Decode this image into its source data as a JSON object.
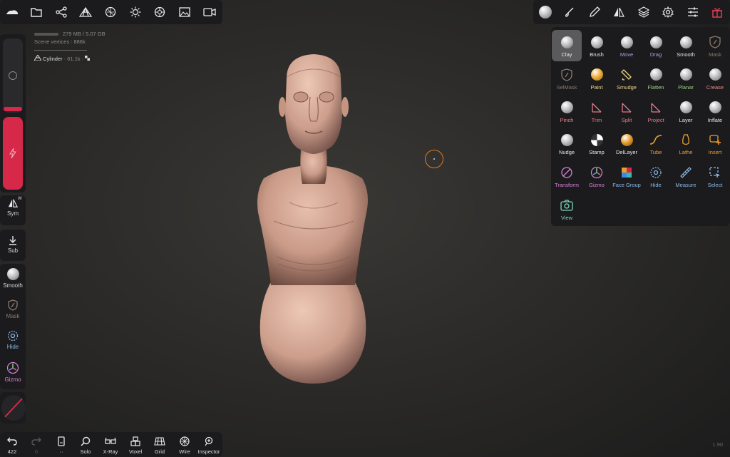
{
  "top_toolbar": {
    "icons": [
      "app-logo-icon",
      "folder-icon",
      "scene-graph-icon",
      "topology-icon",
      "background-icon",
      "light-icon",
      "material-icon",
      "image-icon",
      "video-icon"
    ]
  },
  "top_right_toolbar": {
    "icons": [
      "brush-sphere-icon",
      "paint-brush-icon",
      "pen-tool-icon",
      "symmetry-icon",
      "layers-icon",
      "settings-gear-icon",
      "sliders-icon",
      "gift-icon"
    ],
    "accent": "#e84055"
  },
  "scene_info": {
    "memory": "279 MB / 5.07 GB",
    "vertices": "Scene vertices : 888k",
    "object_name": "Cylinder",
    "object_detail": "· 61.1k ·"
  },
  "left_panel": {
    "sym_label": "Sym",
    "sym_badge": "W",
    "sub_label": "Sub",
    "smooth_label": "Smooth",
    "mask_label": "Mask",
    "hide_label": "Hide",
    "gizmo_label": "Gizmo",
    "slider_accent": "#d6294a"
  },
  "tools": [
    {
      "name": "Clay",
      "color": "#e8e8e8"
    },
    {
      "name": "Brush",
      "color": "#e8e8e8"
    },
    {
      "name": "Move",
      "color": "#a9a7e8"
    },
    {
      "name": "Drag",
      "color": "#a9a7e8"
    },
    {
      "name": "Smooth",
      "color": "#e8e8e8"
    },
    {
      "name": "Mask",
      "color": "#8a7a6a"
    },
    {
      "name": "SelMask",
      "color": "#8a7a6a"
    },
    {
      "name": "Paint",
      "color": "#f0d58a"
    },
    {
      "name": "Smudge",
      "color": "#f0d58a"
    },
    {
      "name": "Flatten",
      "color": "#9ad18a"
    },
    {
      "name": "Planar",
      "color": "#9ad18a"
    },
    {
      "name": "Crease",
      "color": "#e88a8a"
    },
    {
      "name": "Pinch",
      "color": "#e88a8a"
    },
    {
      "name": "Trim",
      "color": "#e07a8a"
    },
    {
      "name": "Split",
      "color": "#e07a8a"
    },
    {
      "name": "Project",
      "color": "#e07a8a"
    },
    {
      "name": "Layer",
      "color": "#e8e8e8"
    },
    {
      "name": "Inflate",
      "color": "#e8e8e8"
    },
    {
      "name": "Nudge",
      "color": "#e8e8e8"
    },
    {
      "name": "Stamp",
      "color": "#e8e8e8"
    },
    {
      "name": "DelLayer",
      "color": "#e8e8e8"
    },
    {
      "name": "Tube",
      "color": "#e8a030"
    },
    {
      "name": "Lathe",
      "color": "#e8a030"
    },
    {
      "name": "Insert",
      "color": "#e8a030"
    },
    {
      "name": "Transform",
      "color": "#d880d8"
    },
    {
      "name": "Gizmo",
      "color": "#d880d8"
    },
    {
      "name": "Face Group",
      "color": "#8ab8e8"
    },
    {
      "name": "Hide",
      "color": "#8ab8e8"
    },
    {
      "name": "Measure",
      "color": "#8ab8e8"
    },
    {
      "name": "Select",
      "color": "#8ab8e8"
    },
    {
      "name": "View",
      "color": "#7ad8b8"
    }
  ],
  "bottom_toolbar": {
    "undo_count": "422",
    "redo_count": "0",
    "items": [
      "Solo",
      "X-Ray",
      "Voxel",
      "Grid",
      "Wire",
      "Inspector"
    ]
  },
  "version": "1.90"
}
